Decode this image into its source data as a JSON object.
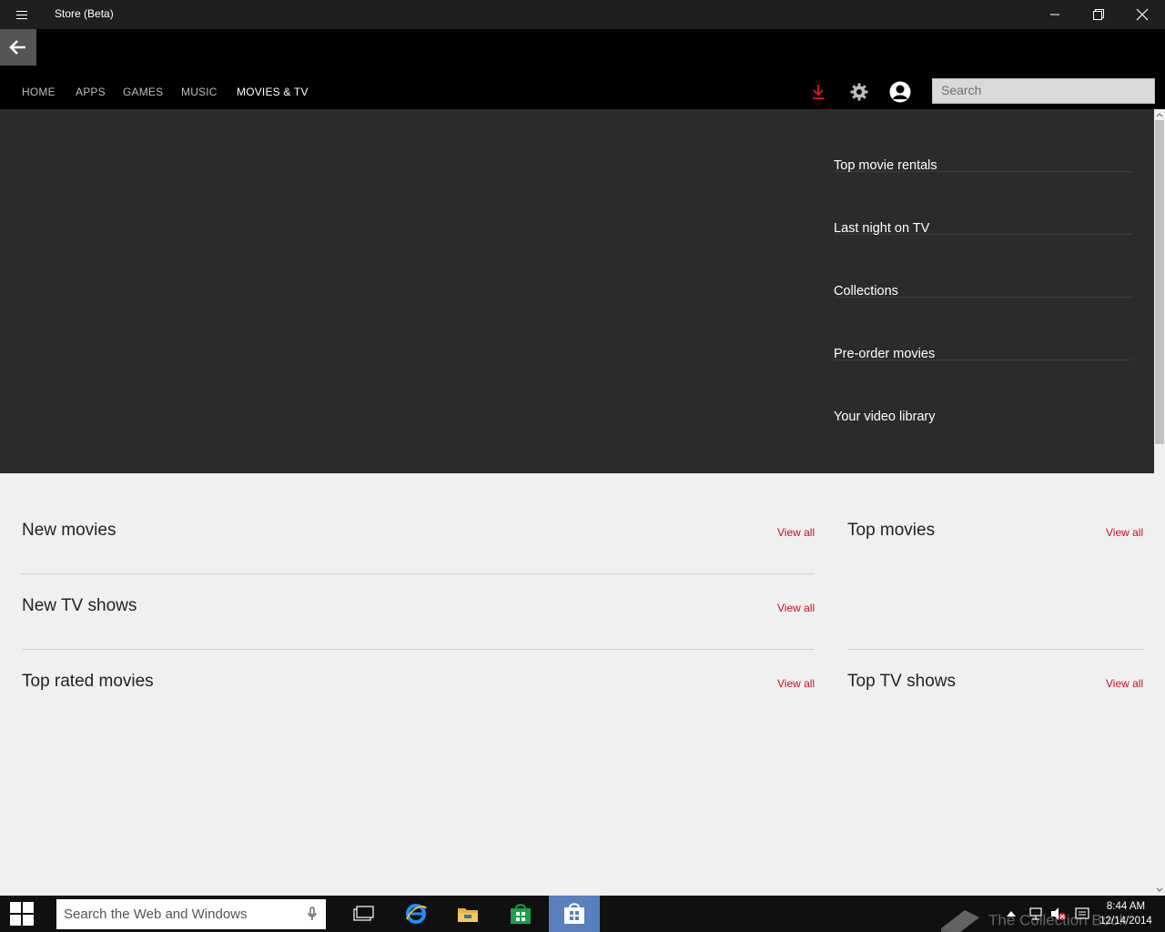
{
  "window": {
    "title": "Store (Beta)"
  },
  "nav": {
    "tabs": [
      {
        "label": "HOME"
      },
      {
        "label": "APPS"
      },
      {
        "label": "GAMES"
      },
      {
        "label": "MUSIC"
      },
      {
        "label": "MOVIES & TV",
        "active": true
      }
    ],
    "search_placeholder": "Search",
    "download_accent": "#e81123"
  },
  "hero": {
    "links": [
      "Top movie rentals",
      "Last night on TV",
      "Collections",
      "Pre-order movies",
      "Your video library"
    ]
  },
  "sections": {
    "new_movies": {
      "title": "New movies",
      "view_all": "View all"
    },
    "new_tv": {
      "title": "New TV shows",
      "view_all": "View all"
    },
    "top_rated": {
      "title": "Top rated movies",
      "view_all": "View all"
    },
    "top_movies": {
      "title": "Top movies",
      "view_all": "View all"
    },
    "top_tv": {
      "title": "Top TV shows",
      "view_all": "View all"
    }
  },
  "taskbar": {
    "search_placeholder": "Search the Web and Windows",
    "time": "8:44 AM",
    "date": "12/14/2014"
  },
  "watermark": "The Collection Book",
  "colors": {
    "accent_link": "#c50e1f",
    "hero_bg": "#2b2b2b",
    "content_bg": "#f0f0f0",
    "taskbar_active": "#5a7fbd"
  }
}
